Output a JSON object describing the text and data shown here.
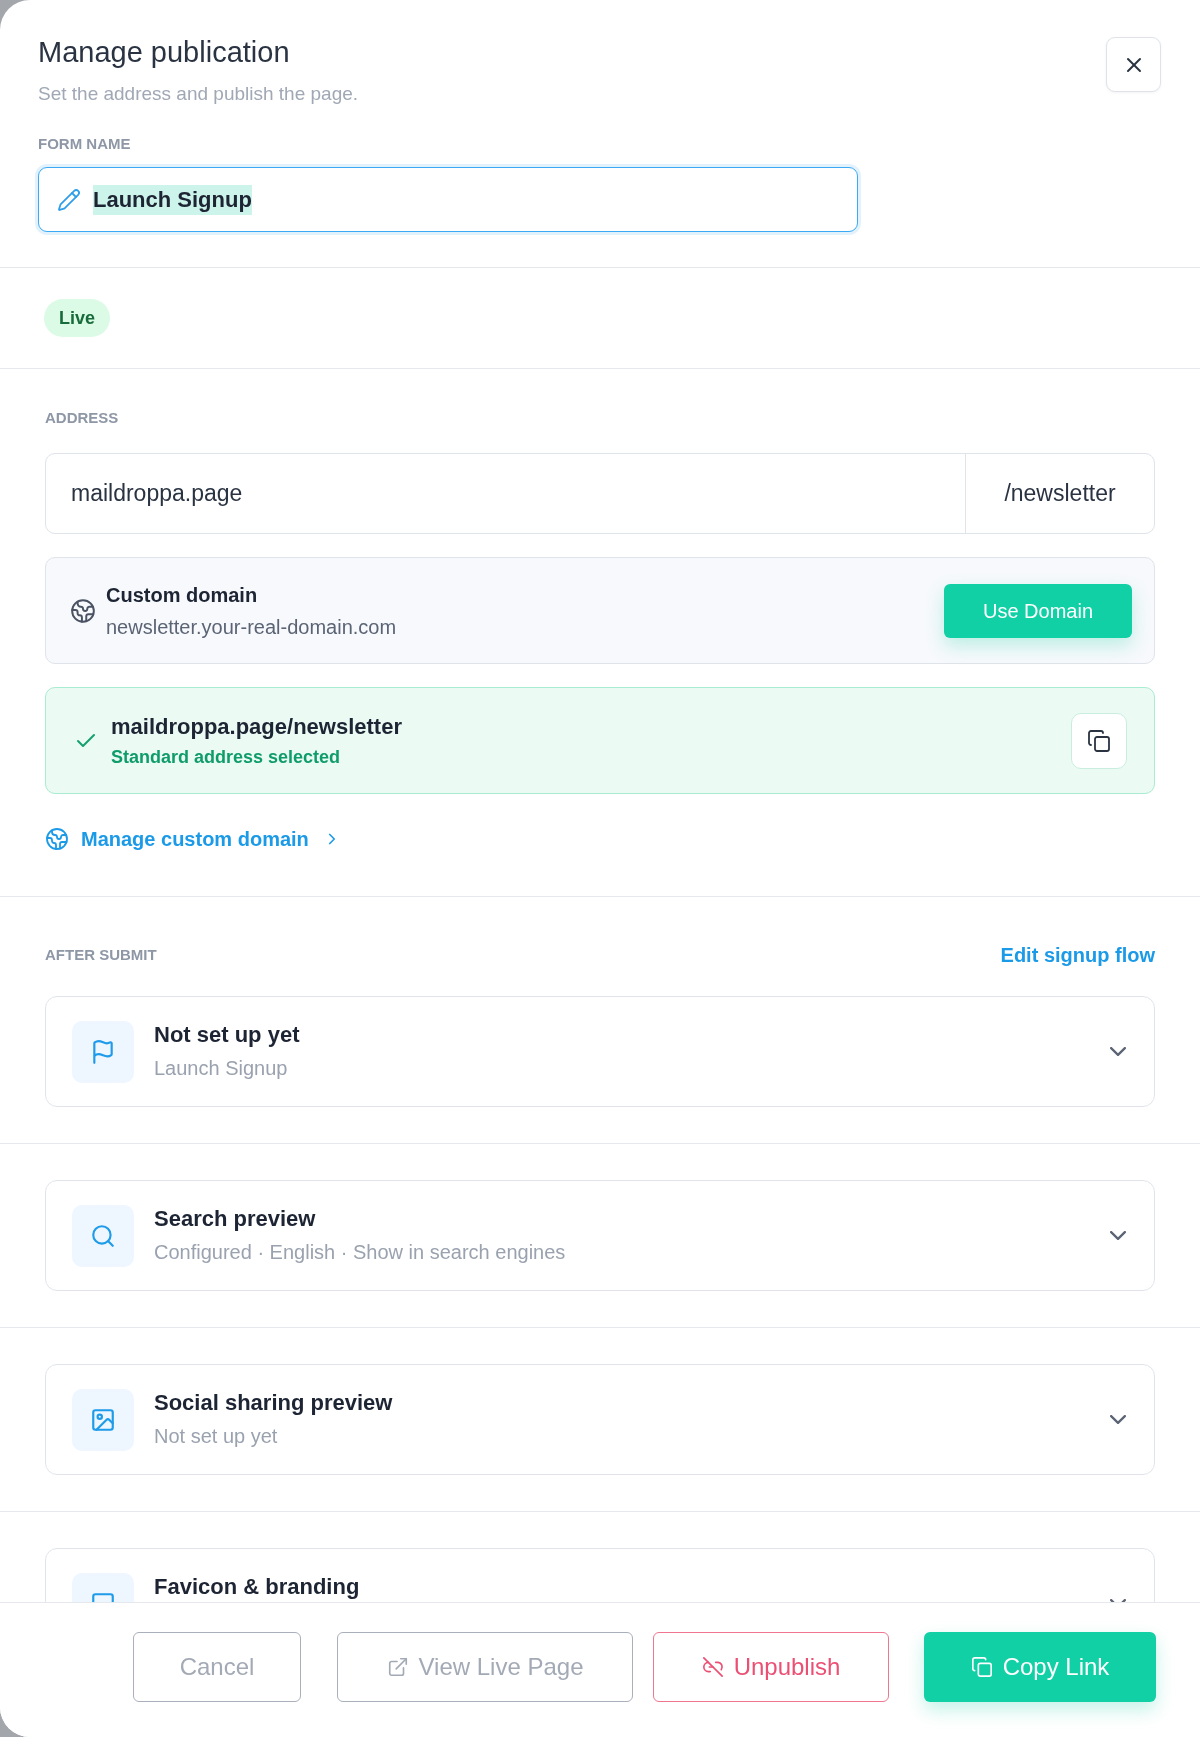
{
  "dialog": {
    "title": "Manage publication",
    "subtitle": "Set the address and publish the page."
  },
  "form_name": {
    "label": "FORM NAME",
    "value": "Launch Signup",
    "focused": true,
    "value_selected": true
  },
  "status": {
    "label": "Live"
  },
  "address": {
    "label": "ADDRESS",
    "domain": "maildroppa.page",
    "slug": "/newsletter"
  },
  "custom_domain": {
    "title": "Custom domain",
    "domain": "newsletter.your-real-domain.com",
    "button": "Use Domain"
  },
  "selected_address": {
    "url": "maildroppa.page/newsletter",
    "note": "Standard address selected"
  },
  "manage_link": "Manage custom domain",
  "after_submit": {
    "label": "AFTER SUBMIT",
    "link": "Edit signup flow",
    "card": {
      "kind": "flag",
      "title": "Not set up yet",
      "subtitle": "Launch Signup",
      "expanded": false
    }
  },
  "sections": [
    {
      "kind": "search",
      "title": "Search preview",
      "subtitle": "Configured · English · Show in search engines",
      "expanded": false
    },
    {
      "kind": "image",
      "title": "Social sharing preview",
      "subtitle": "Not set up yet",
      "expanded": false
    },
    {
      "kind": "square",
      "title": "Favicon & branding",
      "expanded": false
    }
  ],
  "footer_buttons": [
    {
      "kind": "cancel",
      "label": "Cancel"
    },
    {
      "kind": "view",
      "label": "View Live Page"
    },
    {
      "kind": "unpublish",
      "label": "Unpublish"
    },
    {
      "kind": "copy",
      "label": "Copy Link"
    }
  ]
}
